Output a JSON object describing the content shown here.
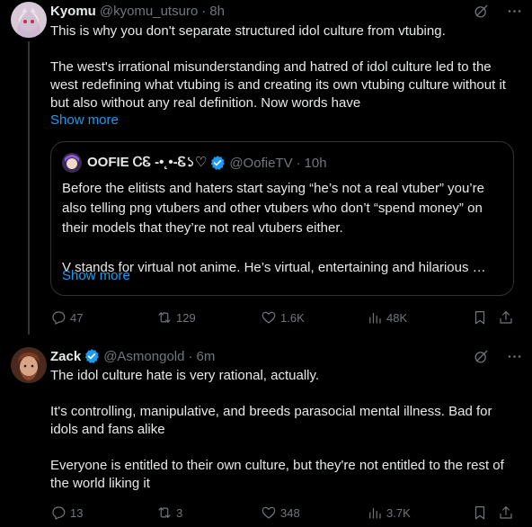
{
  "tweet1": {
    "name": "Kyomu",
    "handle": "@kyomu_utsuro",
    "time": "8h",
    "text": "This is why you don't separate structured idol culture from vtubing.\n\nThe west's irrational misunderstanding and hatred of idol culture led to the west redefining what vtubing is and creating its own vtubing culture without it but also without any real definition. Now words have",
    "show_more": "Show more",
    "quote": {
      "name": "OOFIE ᏟᏋ -•˛•-Ꮛ১♡",
      "handle": "@OofieTV",
      "time": "10h",
      "text": "Before the elitists and haters start saying “he’s not a real vtuber” you’re also telling png vtubers and other vtubers who don’t “spend money” on their models that they’re not real vtubers either.\n\nV stands for virtual not anime. He’s virtual, entertaining and hilarious …",
      "show_more": "Show more"
    },
    "actions": {
      "replies": "47",
      "reposts": "129",
      "likes": "1.6K",
      "views": "48K"
    }
  },
  "tweet2": {
    "name": "Zack",
    "handle": "@Asmongold",
    "time": "6m",
    "text": "The idol culture hate is very rational, actually.\n\nIt's controlling, manipulative, and breeds parasocial mental illness. Bad for idols and fans alike\n\nEveryone is entitled to their own culture, but they're not entitled to the rest of the world liking it",
    "actions": {
      "replies": "13",
      "reposts": "3",
      "likes": "348",
      "views": "3.7K"
    }
  },
  "colors": {
    "accent": "#1d9bf0",
    "muted": "#71767b",
    "text": "#e7e9ea",
    "border": "#2f3336"
  }
}
